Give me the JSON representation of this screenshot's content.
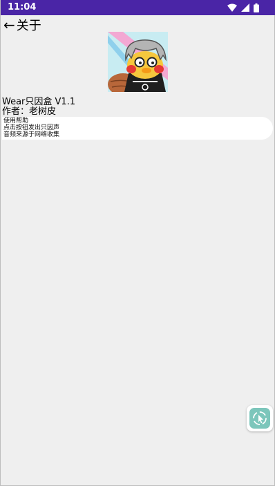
{
  "status_bar": {
    "time": "11:04",
    "icons": [
      "wifi-icon",
      "signal-icon",
      "battery-icon"
    ]
  },
  "header": {
    "back_glyph": "←",
    "title": "关于"
  },
  "app": {
    "name": "Wear只因盒 V1.1",
    "author": "作者：老树皮"
  },
  "help": {
    "lines": [
      "使用帮助",
      "点击按钮发出只因声",
      "音频来源于网络收集"
    ]
  },
  "colors": {
    "status_bar": "#4a25a6",
    "background": "#efefef",
    "fab_accent": "#7cc6bb"
  }
}
